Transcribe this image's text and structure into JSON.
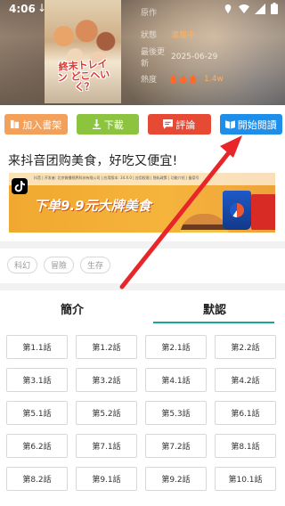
{
  "status_bar": {
    "time": "4:06",
    "download": "↓"
  },
  "book": {
    "cover_title": "終末トレイン どこへいく？",
    "info": [
      {
        "key": "原作",
        "value": ""
      },
      {
        "key": "狀態",
        "value": "連載中"
      },
      {
        "key": "最後更新",
        "value": "2025-06-29"
      },
      {
        "key": "熱度",
        "value": "1.4w"
      }
    ]
  },
  "actions": {
    "add_shelf": "加入書架",
    "download": "下載",
    "comment": "評論",
    "start_read": "開始閱讀"
  },
  "ad": {
    "title": "来抖音团购美食，好吃又便宜!",
    "fine_print": "抖音 | 开发者: 北京微播视界科技有限公司 | 应用版本: 34.X.0 | 应用权限 | 隐私政策 | 功能介绍 | 备案号",
    "slogan": "下单9.9元大牌美食"
  },
  "tags": [
    "科幻",
    "冒險",
    "生存"
  ],
  "tabs": {
    "intro": "簡介",
    "default": "默認"
  },
  "chapters": [
    "第1.1話",
    "第1.2話",
    "第2.1話",
    "第2.2話",
    "第3.1話",
    "第3.2話",
    "第4.1話",
    "第4.2話",
    "第5.1話",
    "第5.2話",
    "第5.3話",
    "第6.1話",
    "第6.2話",
    "第7.1話",
    "第7.2話",
    "第8.1話",
    "第8.2話",
    "第9.1話",
    "第9.2話",
    "第10.1話"
  ],
  "colors": {
    "add_shelf": "#f3a05b",
    "download": "#8dc43f",
    "comment": "#e64a34",
    "start_read": "#1f8ee8",
    "accent_tab": "#1aa39a",
    "annotation_arrow": "#e8262a"
  }
}
